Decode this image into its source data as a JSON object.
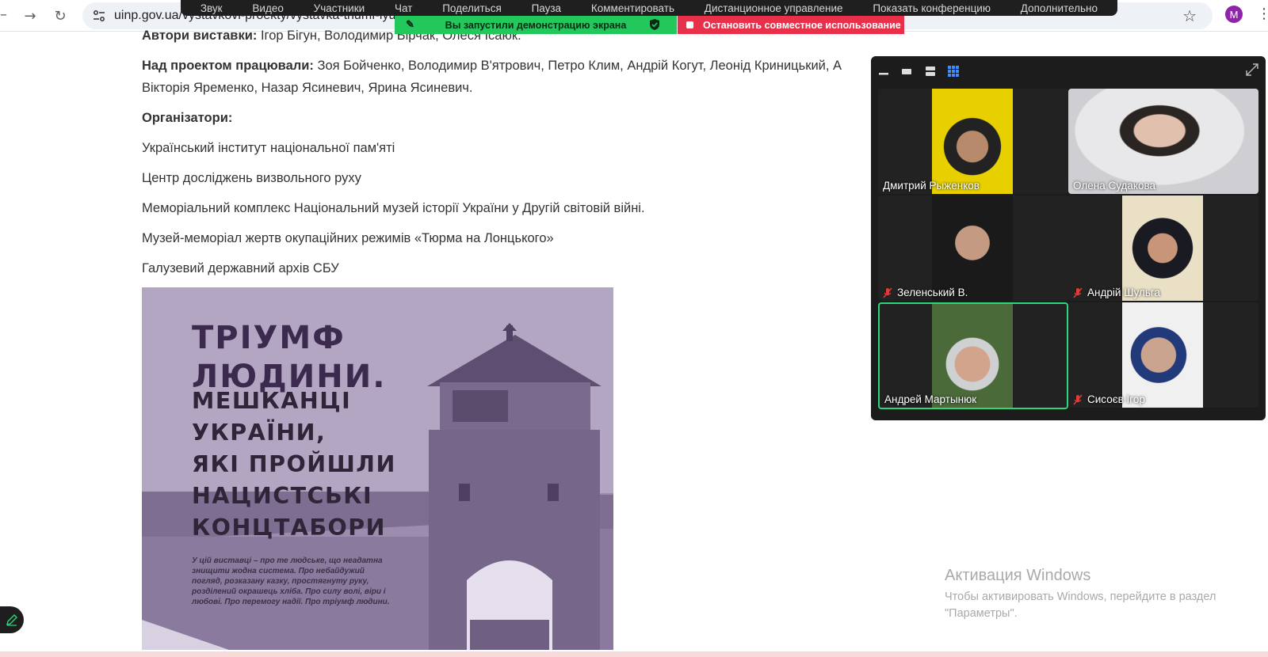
{
  "browser": {
    "url": "uinp.gov.ua/vystavkovi-proekty/vystavka-triumf-lyudy",
    "avatar_letter": "M"
  },
  "zoom_toolbar": {
    "items": [
      "Звук",
      "Видео",
      "Участники",
      "Чат",
      "Поделиться",
      "Пауза",
      "Комментировать",
      "Дистанционное управление",
      "Показать конференцию",
      "Дополнительно"
    ],
    "share_status": "Вы запустили демонстрацию экрана",
    "stop_share": "Остановить совместное использование",
    "status_color": "#23c85d",
    "stop_color": "#e8304a"
  },
  "article": {
    "authors_label": "Автори виставки:",
    "authors": "Ігор Бігун, Володимир Бірчак, Олеся Ісаюк.",
    "worked_label": "Над проектом працювали:",
    "worked_line1": "Зоя Бойченко, Володимир В'ятрович, Петро Клим, Андрій Когут, Леонід Криницький, А",
    "worked_line2": "Вікторія Яременко,  Назар Ясиневич, Ярина Ясиневич.",
    "organizers_label": "Організатори:",
    "organizers": [
      "Український інститут національної пам'яті",
      "Центр досліджень визвольного руху",
      "Меморіальний комплекс Національний музей історії України у Другій світовій війні.",
      "Музей-меморіал жертв окупаційних режимів «Тюрма на Лонцького»",
      "Галузевий державний архів СБУ"
    ]
  },
  "poster": {
    "title_line1": "ТРІУМФ",
    "title_line2": "ЛЮДИНИ.",
    "sub_line1": "МЕШКАНЦІ",
    "sub_line2": "УКРАЇНИ,",
    "sub_line3": "ЯКІ ПРОЙШЛИ",
    "sub_line4": "НАЦИСТСЬКІ",
    "sub_line5": "КОНЦТАБОРИ",
    "description": "У цій виставці – про те людське, що неадатна знищити жодна система. Про небайдужий погляд, розказану казку, простягнуту руку, розділений окрашець хліба. Про силу волі, віри і любові. Про перемогу надії. Про тріумф людини."
  },
  "zoom_gallery": {
    "view_modes": [
      "minimize-icon",
      "thumbnail-icon",
      "speaker-view-icon",
      "gallery-view-icon"
    ],
    "participants": [
      {
        "name": "Дмитрий Рыженков",
        "muted": false,
        "active": false
      },
      {
        "name": "Олена Судакова",
        "muted": false,
        "active": false
      },
      {
        "name": "Зеленський В.",
        "muted": true,
        "active": false
      },
      {
        "name": "Андрій Шульга",
        "muted": true,
        "active": false
      },
      {
        "name": "Андрей Мартынюк",
        "muted": false,
        "active": true
      },
      {
        "name": "Сисоєв Ігор",
        "muted": true,
        "active": false
      }
    ],
    "active_border_color": "#2cd67b"
  },
  "windows_watermark": {
    "title": "Активация Windows",
    "text": "Чтобы активировать Windows, перейдите в раздел \"Параметры\"."
  }
}
